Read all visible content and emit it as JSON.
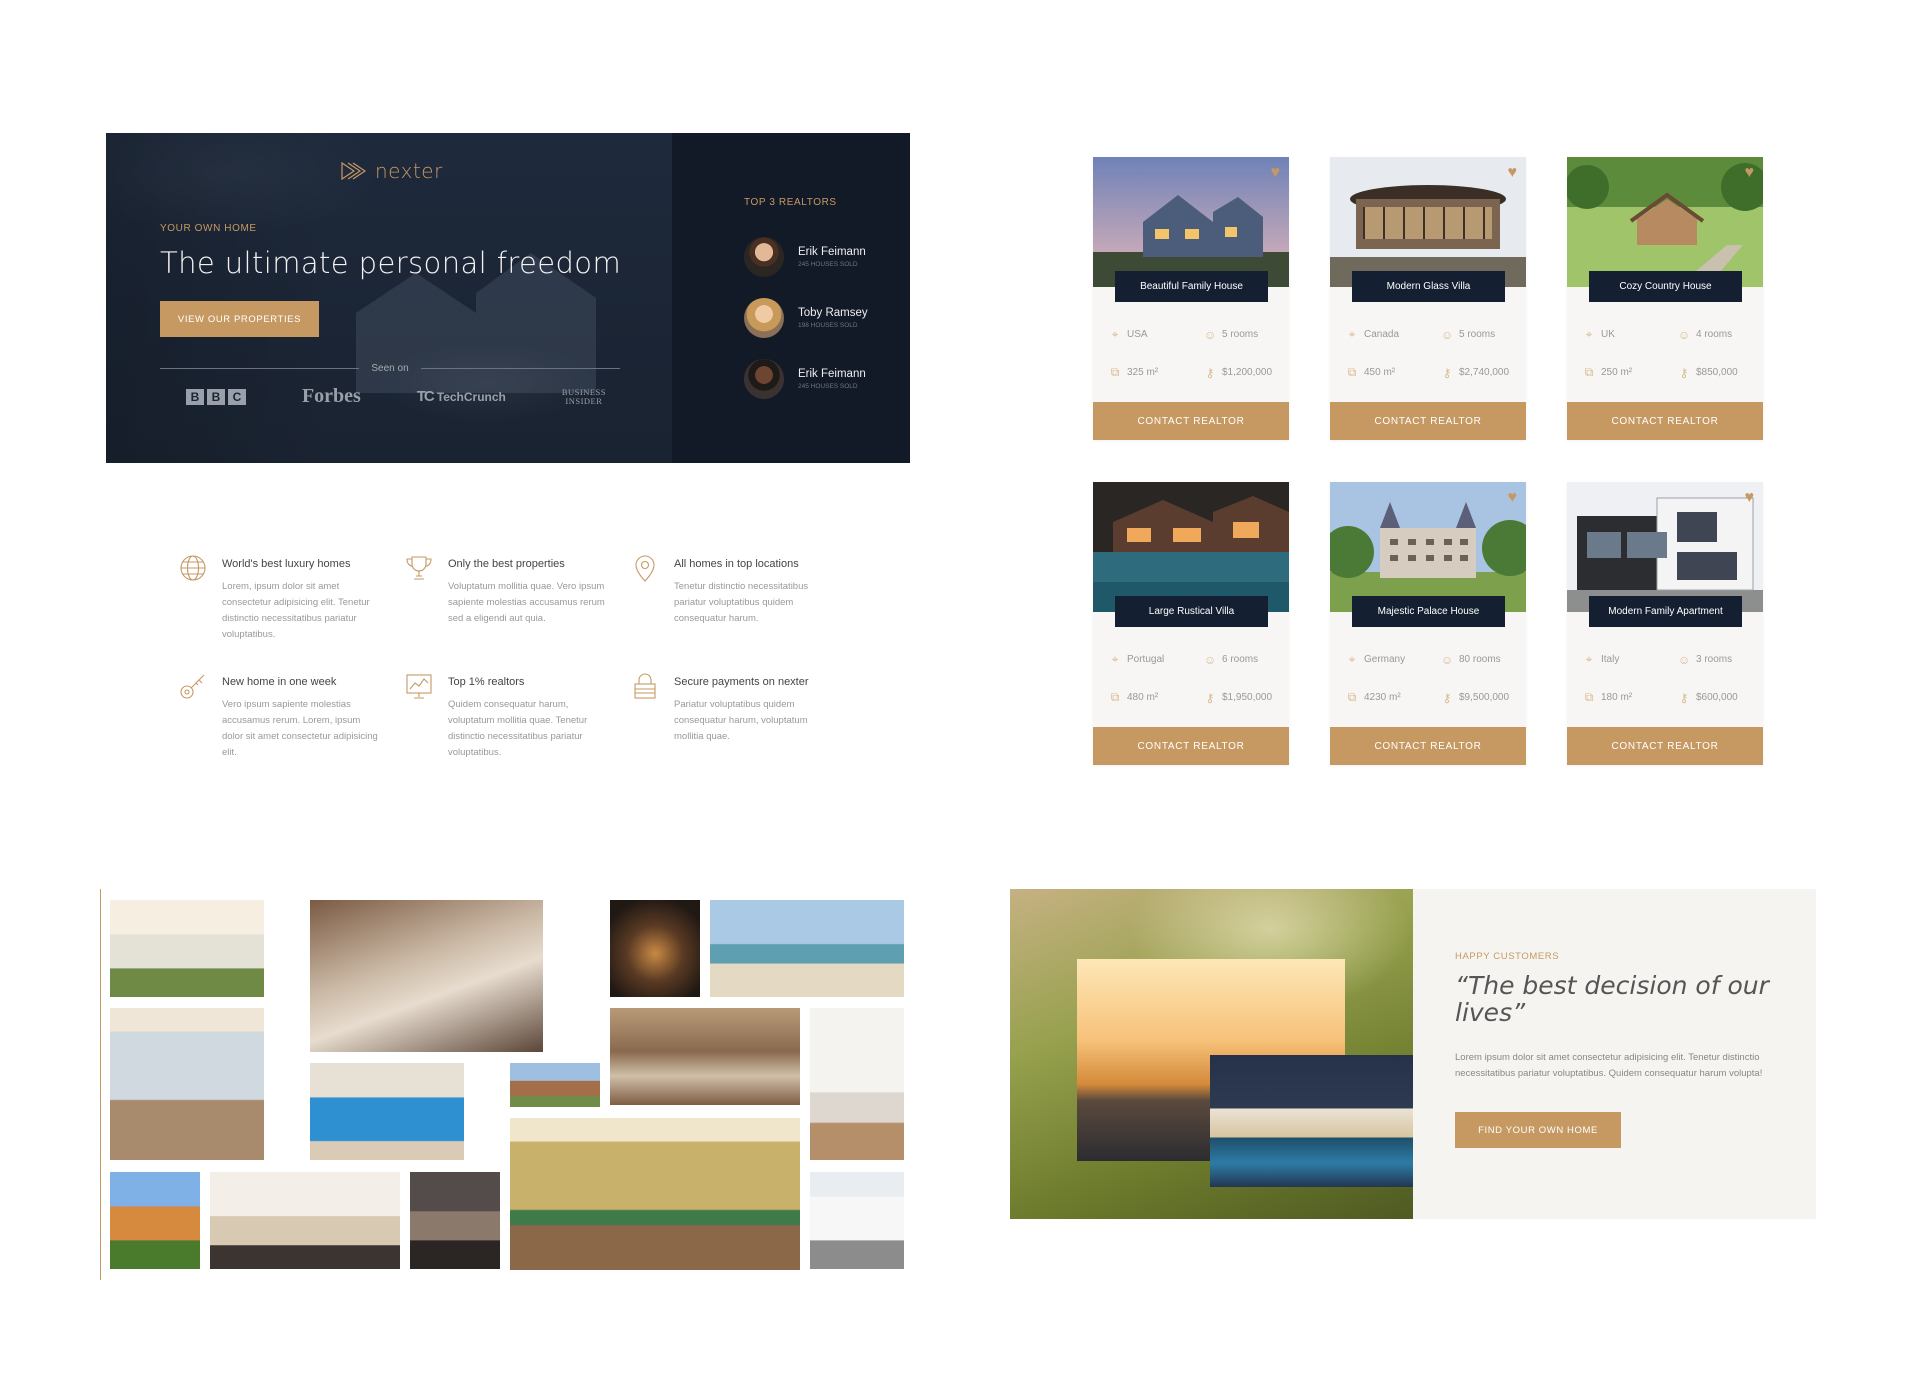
{
  "hero": {
    "logo": "nexter",
    "eyebrow": "Your own home",
    "title": "The ultimate personal freedom",
    "button": "View our properties",
    "seen_on": "Seen on",
    "press": {
      "bbc": [
        "B",
        "B",
        "C"
      ],
      "forbes": "Forbes",
      "techcrunch_mark": "TC",
      "techcrunch": "TechCrunch",
      "business": "Business",
      "insider": "Insider"
    }
  },
  "realtors": {
    "title": "Top 3 realtors",
    "items": [
      {
        "name": "Erik Feimann",
        "sold": "245 houses sold"
      },
      {
        "name": "Toby Ramsey",
        "sold": "198 houses sold"
      },
      {
        "name": "Erik Feimann",
        "sold": "245 houses sold"
      }
    ]
  },
  "features": [
    {
      "icon": "globe-icon",
      "title": "World's best luxury homes",
      "text": "Lorem, ipsum dolor sit amet consectetur adipisicing elit. Tenetur distinctio necessitatibus pariatur voluptatibus."
    },
    {
      "icon": "trophy-icon",
      "title": "Only the best properties",
      "text": "Voluptatum mollitia quae. Vero ipsum sapiente molestias accusamus rerum sed a eligendi aut quia."
    },
    {
      "icon": "map-pin-icon",
      "title": "All homes in top locations",
      "text": "Tenetur distinctio necessitatibus pariatur voluptatibus quidem consequatur harum."
    },
    {
      "icon": "key-icon",
      "title": "New home in one week",
      "text": "Vero ipsum sapiente molestias accusamus rerum. Lorem, ipsum dolor sit amet consectetur adipisicing elit."
    },
    {
      "icon": "chart-icon",
      "title": "Top 1% realtors",
      "text": "Quidem consequatur harum, voluptatum mollitia quae. Tenetur distinctio necessitatibus pariatur voluptatibus."
    },
    {
      "icon": "lock-icon",
      "title": "Secure payments on nexter",
      "text": "Pariatur voluptatibus quidem consequatur harum, voluptatum mollitia quae."
    }
  ],
  "cards": [
    {
      "name": "Beautiful Family House",
      "country": "USA",
      "rooms": "5 rooms",
      "area": "325 m²",
      "price": "$1,200,000",
      "button": "Contact realtor",
      "favorite": true
    },
    {
      "name": "Modern Glass Villa",
      "country": "Canada",
      "rooms": "5 rooms",
      "area": "450 m²",
      "price": "$2,740,000",
      "button": "Contact realtor",
      "favorite": true
    },
    {
      "name": "Cozy Country House",
      "country": "UK",
      "rooms": "4 rooms",
      "area": "250 m²",
      "price": "$850,000",
      "button": "Contact realtor",
      "favorite": true
    },
    {
      "name": "Large Rustical Villa",
      "country": "Portugal",
      "rooms": "6 rooms",
      "area": "480 m²",
      "price": "$1,950,000",
      "button": "Contact realtor",
      "favorite": false
    },
    {
      "name": "Majestic Palace House",
      "country": "Germany",
      "rooms": "80 rooms",
      "area": "4230 m²",
      "price": "$9,500,000",
      "button": "Contact realtor",
      "favorite": true
    },
    {
      "name": "Modern Family Apartment",
      "country": "Italy",
      "rooms": "3 rooms",
      "area": "180 m²",
      "price": "$600,000",
      "button": "Contact realtor",
      "favorite": true
    }
  ],
  "testimonial": {
    "eyebrow": "Happy customers",
    "quote": "“The best decision of our lives”",
    "text": "Lorem ipsum dolor sit amet consectetur adipisicing elit. Tenetur distinctio necessitatibus pariatur voluptatibus. Quidem consequatur harum volupta!",
    "button": "Find your own home"
  },
  "colors": {
    "accent": "#c69963",
    "dark": "#142032",
    "light": "#f7f6f4"
  }
}
